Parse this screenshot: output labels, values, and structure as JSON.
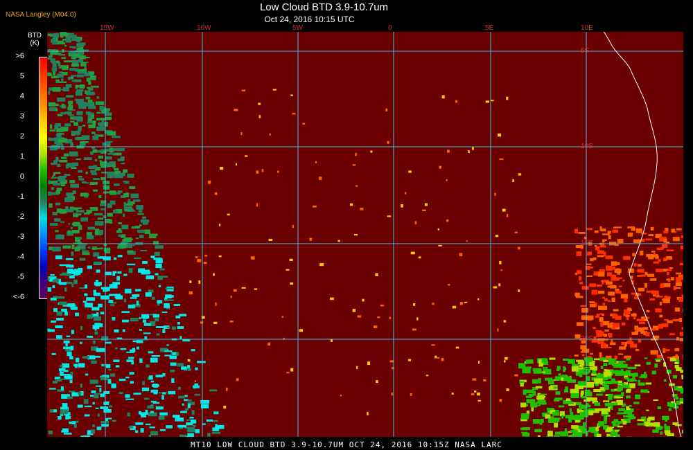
{
  "header": {
    "credit": "NASA Langley (M04.0)",
    "title": "Low Cloud BTD 3.9-10.7um",
    "subtitle": "Oct 24, 2016 10:15 UTC"
  },
  "legend": {
    "title_line1": "BTD",
    "title_line2": "(K)",
    "ticks": [
      ">6",
      "5",
      "4",
      "3",
      "2",
      "1",
      "0",
      "-1",
      "-2",
      "-3",
      "-4",
      "-5",
      "<-6"
    ],
    "colors": [
      "#ff0000",
      "#ff3000",
      "#ff6000",
      "#ff9000",
      "#ffcc00",
      "#ffff00",
      "#b0e000",
      "#20c000",
      "#008000",
      "#208060",
      "#00e0e0",
      "#0090ff",
      "#0040ff",
      "#0000c0",
      "#400080",
      "#600060"
    ]
  },
  "map": {
    "lon_labels": [
      "15W",
      "10W",
      "5W",
      "0",
      "5E",
      "10E"
    ],
    "lat_labels": [
      "5S",
      "10S",
      "15S",
      "20S"
    ],
    "grid_color": "#40c0e0",
    "background_color": "#6b0000",
    "coast_color": "#ffffff"
  },
  "footer": {
    "text": "MT10  LOW CLOUD BTD 3.9-10.7UM   OCT 24, 2016 10:15Z   NASA LARC"
  }
}
